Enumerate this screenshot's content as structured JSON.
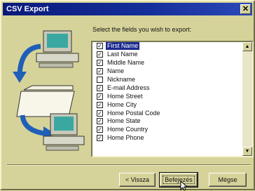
{
  "window": {
    "title": "CSV Export",
    "close_symbol": "✕",
    "icons": [
      "computer-icon",
      "arrow-icon",
      "folder-icon"
    ]
  },
  "prompt": "Select the fields you wish to export:",
  "fields": [
    {
      "label": "First Name",
      "checked": true,
      "selected": true
    },
    {
      "label": "Last Name",
      "checked": true
    },
    {
      "label": "Middle Name",
      "checked": true
    },
    {
      "label": "Name",
      "checked": true
    },
    {
      "label": "Nickname",
      "checked": false
    },
    {
      "label": "E-mail Address",
      "checked": true
    },
    {
      "label": "Home Street",
      "checked": true
    },
    {
      "label": "Home City",
      "checked": true
    },
    {
      "label": "Home Postal Code",
      "checked": true
    },
    {
      "label": "Home State",
      "checked": true
    },
    {
      "label": "Home Country",
      "checked": true
    },
    {
      "label": "Home Phone",
      "checked": true
    }
  ],
  "scrollbar": {
    "up": "▲",
    "down": "▼"
  },
  "buttons": {
    "back": "< Vissza",
    "finish": "Befejezés",
    "cancel": "Mégse"
  },
  "colors": {
    "titlebar": "#15309c",
    "dialog_bg": "#d6d39a",
    "selection": "#1b2b8e"
  }
}
